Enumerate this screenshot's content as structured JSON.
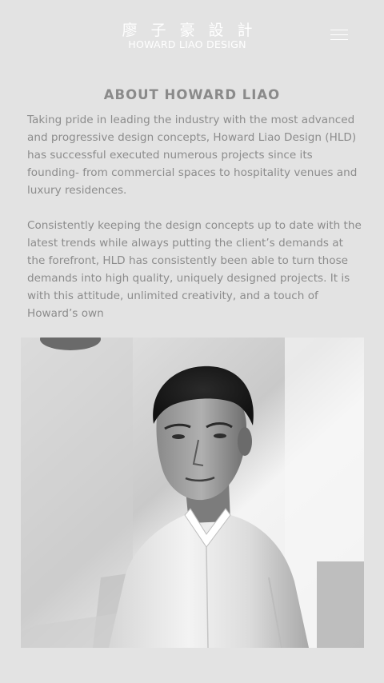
{
  "header": {
    "logo_chinese": "廖子豪設計",
    "logo_english": "HOWARD LIAO DESIGN",
    "menu_icon": "hamburger-menu-icon"
  },
  "about": {
    "title": "ABOUT HOWARD LIAO",
    "paragraphs": [
      "Taking pride in leading the industry with the most advanced and progressive design concepts, Howard Liao Design (HLD) has successful executed numerous projects since its founding- from commercial spaces to hospitality venues and luxury residences.",
      "Consistently keeping the design concepts up to date with the latest trends while always putting the client’s demands at the forefront, HLD has consistently been able to turn those demands into high quality, uniquely designed projects. It is with this attitude, unlimited creativity, and a touch of Howard’s own"
    ]
  },
  "portrait": {
    "subject": "black-and-white portrait photo of a man in a white collared shirt"
  },
  "colors": {
    "background": "#e3e3e3",
    "text": "#8c8c8c",
    "logo": "#ffffff"
  }
}
